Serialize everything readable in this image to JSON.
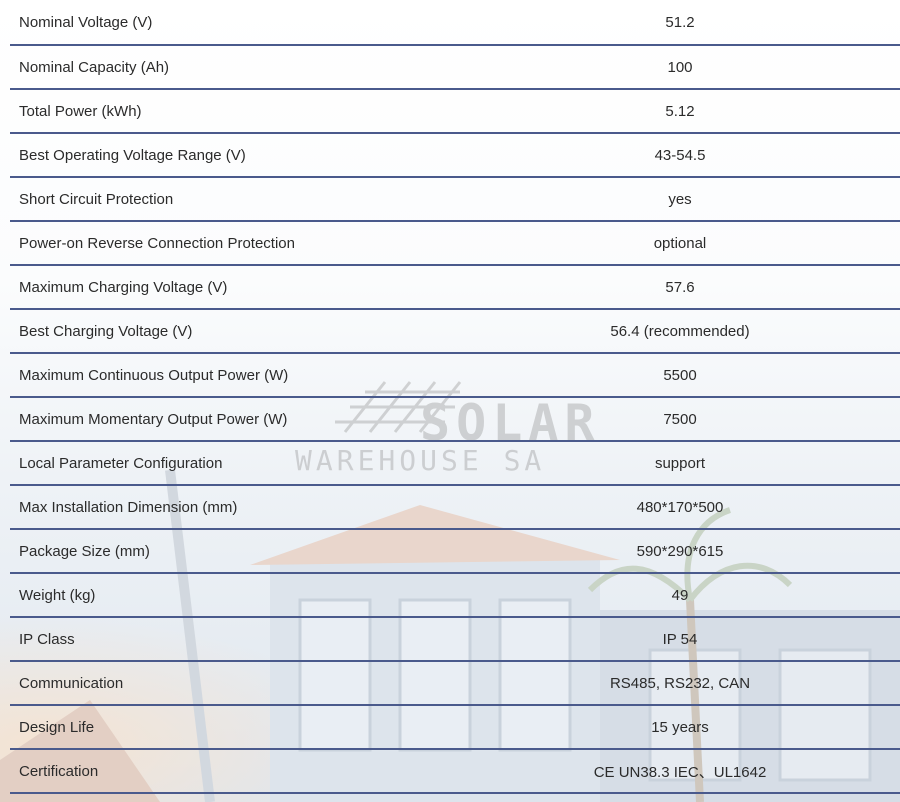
{
  "watermark": {
    "line1": "SOLAR",
    "line2": "WAREHOUSE SA"
  },
  "specs": [
    {
      "label": "Nominal Voltage (V)",
      "value": "51.2"
    },
    {
      "label": "Nominal Capacity (Ah)",
      "value": "100"
    },
    {
      "label": "Total Power (kWh)",
      "value": "5.12"
    },
    {
      "label": "Best Operating Voltage Range (V)",
      "value": "43-54.5"
    },
    {
      "label": "Short Circuit Protection",
      "value": "yes"
    },
    {
      "label": "Power-on Reverse Connection Protection",
      "value": "optional"
    },
    {
      "label": "Maximum Charging Voltage (V)",
      "value": "57.6"
    },
    {
      "label": "Best Charging Voltage (V)",
      "value": "56.4 (recommended)"
    },
    {
      "label": "Maximum Continuous Output Power (W)",
      "value": "5500"
    },
    {
      "label": "Maximum Momentary Output Power (W)",
      "value": "7500"
    },
    {
      "label": "Local Parameter Configuration",
      "value": "support"
    },
    {
      "label": "Max Installation Dimension (mm)",
      "value": "480*170*500"
    },
    {
      "label": "Package Size (mm)",
      "value": "590*290*615"
    },
    {
      "label": "Weight (kg)",
      "value": "49"
    },
    {
      "label": "IP Class",
      "value": "IP 54"
    },
    {
      "label": "Communication",
      "value": "RS485, RS232, CAN"
    },
    {
      "label": "Design Life",
      "value": "15 years"
    },
    {
      "label": "Certification",
      "value": "CE UN38.3 IEC、UL1642"
    }
  ]
}
